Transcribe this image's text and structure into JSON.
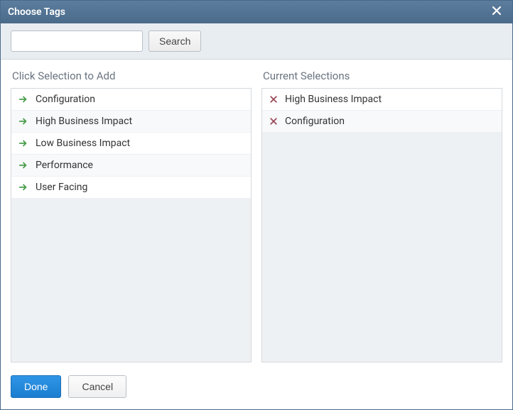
{
  "dialog": {
    "title": "Choose Tags"
  },
  "search": {
    "value": "",
    "placeholder": "",
    "button_label": "Search"
  },
  "columns": {
    "available_header": "Click Selection to Add",
    "selected_header": "Current Selections"
  },
  "available": [
    {
      "label": "Configuration"
    },
    {
      "label": "High Business Impact"
    },
    {
      "label": "Low Business Impact"
    },
    {
      "label": "Performance"
    },
    {
      "label": "User Facing"
    }
  ],
  "selected": [
    {
      "label": "High Business Impact"
    },
    {
      "label": "Configuration"
    }
  ],
  "footer": {
    "done_label": "Done",
    "cancel_label": "Cancel"
  },
  "colors": {
    "arrow": "#4a9d4a",
    "remove": "#9c4a5a"
  }
}
